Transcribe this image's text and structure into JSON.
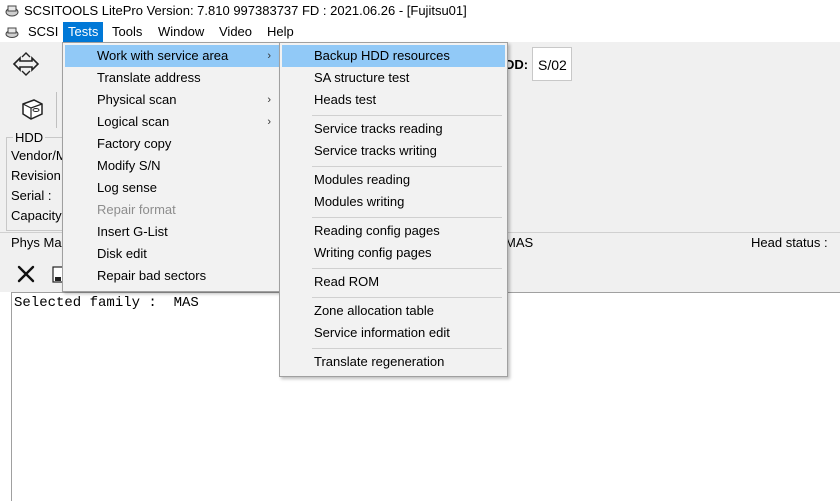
{
  "window": {
    "title": "SCSITOOLS LitePro Version: 7.810   997383737  FD : 2021.06.26 - [Fujitsu01]"
  },
  "menubar": {
    "items": [
      {
        "label": "SCSI"
      },
      {
        "label": "Tests"
      },
      {
        "label": "Tools"
      },
      {
        "label": "Window"
      },
      {
        "label": "Video"
      },
      {
        "label": "Help"
      }
    ]
  },
  "toolbar": {
    "dd_label": "DD:",
    "dd_value": "S/02"
  },
  "hdd_panel": {
    "legend": "HDD",
    "fields": [
      "Vendor/M",
      "Revision",
      "Serial :",
      "Capacity"
    ]
  },
  "status_row": {
    "phys_label": "Phys Ma",
    "family_value": "MAS",
    "head_status": "Head status :"
  },
  "log": {
    "text": "Selected family :  MAS"
  },
  "tests_menu": {
    "items": [
      {
        "label": "Work with service area",
        "arrow": "›"
      },
      {
        "label": "Translate address"
      },
      {
        "label": "Physical scan",
        "arrow": "›"
      },
      {
        "label": "Logical scan",
        "arrow": "›"
      },
      {
        "label": "Factory copy"
      },
      {
        "label": "Modify S/N"
      },
      {
        "label": "Log sense"
      },
      {
        "label": "Repair format"
      },
      {
        "label": "Insert G-List"
      },
      {
        "label": "Disk edit"
      },
      {
        "label": "Repair bad sectors"
      }
    ]
  },
  "service_menu": {
    "items": [
      {
        "label": "Backup HDD resources"
      },
      {
        "label": "SA structure test"
      },
      {
        "label": "Heads test"
      },
      {
        "label": "Service tracks reading"
      },
      {
        "label": "Service tracks writing"
      },
      {
        "label": "Modules reading"
      },
      {
        "label": "Modules writing"
      },
      {
        "label": "Reading config pages"
      },
      {
        "label": "Writing config pages"
      },
      {
        "label": "Read ROM"
      },
      {
        "label": "Zone allocation table"
      },
      {
        "label": "Service information edit"
      },
      {
        "label": "Translate regeneration"
      }
    ]
  },
  "colors": {
    "menu_active": "#0078d7",
    "menu_highlight": "#91c9f7",
    "disabled_text": "#8d8d8d"
  }
}
